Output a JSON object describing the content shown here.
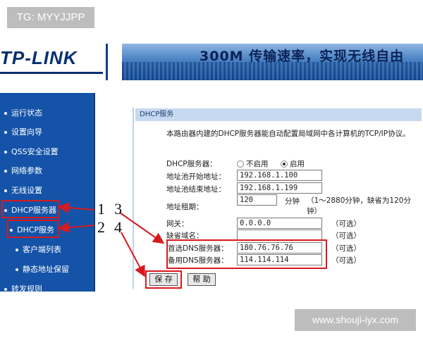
{
  "watermarks": {
    "top_left": "TG: MYYJJPP",
    "bottom_right": "www.shouji-iyx.com"
  },
  "header": {
    "logo": "TP-LINK",
    "slogan": "300M 传输速率，实现无线自由"
  },
  "sidebar": {
    "items": [
      {
        "label": "运行状态"
      },
      {
        "label": "设置向导"
      },
      {
        "label": "QSS安全设置"
      },
      {
        "label": "网络参数"
      },
      {
        "label": "无线设置"
      },
      {
        "label": "DHCP服务器"
      },
      {
        "label": "DHCP服务"
      },
      {
        "label": "客户端列表"
      },
      {
        "label": "静态地址保留"
      },
      {
        "label": "转发规则"
      }
    ]
  },
  "panel": {
    "title": "DHCP服务",
    "description": "本路由器内建的DHCP服务器能自动配置局域网中各计算机的TCP/IP协议。",
    "dhcp_server_label": "DHCP服务器：",
    "option_disable": "不启用",
    "option_enable": "启用",
    "start_addr_label": "地址池开始地址：",
    "start_addr_value": "192.168.1.100",
    "end_addr_label": "地址池结束地址：",
    "end_addr_value": "192.168.1.199",
    "lease_label": "地址租期：",
    "lease_value": "120",
    "lease_unit": "分钟",
    "lease_hint": "（1～2880分钟，缺省为120分钟）",
    "gateway_label": "网关：",
    "gateway_value": "0.0.0.0",
    "domain_label": "缺省域名：",
    "domain_value": "",
    "dns1_label": "首选DNS服务器：",
    "dns1_value": "180.76.76.76",
    "dns2_label": "备用DNS服务器：",
    "dns2_value": "114.114.114",
    "optional": "（可选）",
    "save_label": "保 存",
    "help_label": "帮 助"
  },
  "annotations": {
    "n1": "1",
    "n2": "2",
    "n3": "3",
    "n4": "4"
  },
  "colors": {
    "highlight": "#d9191e",
    "sidebar": "#1453a8"
  }
}
